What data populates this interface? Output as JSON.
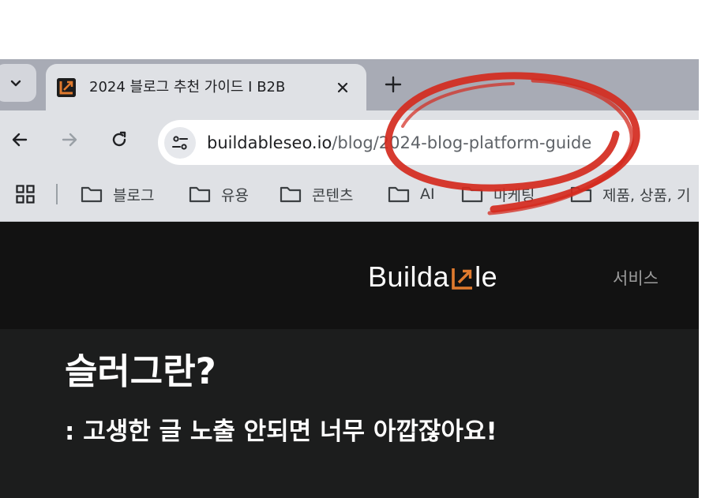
{
  "browser": {
    "tab": {
      "title": "2024 블로그 추천 가이드 I B2B",
      "favicon": "buildable-favicon"
    },
    "new_tab_label": "+",
    "address_bar": {
      "domain": "buildableseo.io",
      "path": "/blog/2024-blog-platform-guide"
    },
    "bookmarks": [
      {
        "label": "블로그",
        "icon": "folder-icon"
      },
      {
        "label": "유용",
        "icon": "folder-icon"
      },
      {
        "label": "콘텐츠",
        "icon": "folder-icon"
      },
      {
        "label": "AI",
        "icon": "folder-icon"
      },
      {
        "label": "마케팅",
        "icon": "folder-icon"
      },
      {
        "label": "제품, 상품, 기",
        "icon": "folder-icon"
      }
    ]
  },
  "site": {
    "logo": {
      "prefix": "Builda",
      "suffix": "le",
      "mark_color": "#e07a2e"
    },
    "nav": {
      "service": "서비스"
    },
    "hero": {
      "title": "슬러그란?",
      "subtitle": ": 고생한 글 노출 안되면 너무 아깝잖아요!"
    }
  },
  "annotation": {
    "type": "red-circle",
    "color": "#d42a1e"
  }
}
